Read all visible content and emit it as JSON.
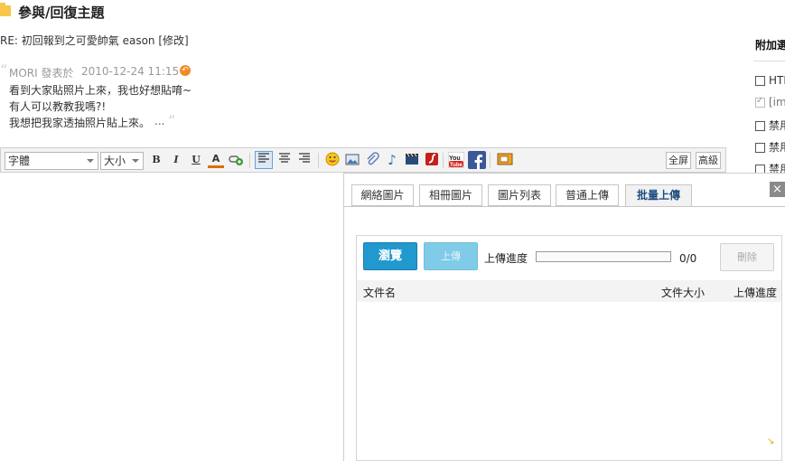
{
  "header": {
    "title": "參與/回復主題",
    "subject": "RE: 初回報到之可愛帥氣 eason [修改]"
  },
  "quote": {
    "author": "MORI 發表於",
    "date": "2010-12-24 11:15",
    "lines": [
      "看到大家貼照片上來，我也好想貼唷~",
      "有人可以教教我嗎?!",
      "我想把我家透抽照片貼上來。"
    ],
    "ellipsis": "..."
  },
  "toolbar": {
    "font_select": "字體",
    "size_select": "大小",
    "bold": "B",
    "italic": "I",
    "underline": "U",
    "fontcolor": "A",
    "fullscreen": "全屏",
    "advanced": "高級"
  },
  "sidebar": {
    "title": "附加選項",
    "options": [
      {
        "label": "HTML",
        "checked": false
      },
      {
        "label": "[img]",
        "checked": true
      },
      {
        "label": "禁用",
        "checked": false
      },
      {
        "label": "禁用",
        "checked": false
      },
      {
        "label": "禁用",
        "checked": false
      }
    ]
  },
  "dialog": {
    "tabs": [
      {
        "label": "網絡圖片"
      },
      {
        "label": "相冊圖片"
      },
      {
        "label": "圖片列表"
      },
      {
        "label": "普通上傳"
      },
      {
        "label": "批量上傳"
      }
    ],
    "active_tab": 4,
    "browse_button": "瀏覽",
    "upload_button": "上傳",
    "progress_label": "上傳進度",
    "progress_fraction": 0,
    "progress_count": "0/0",
    "delete_button": "刪除",
    "columns": {
      "name": "文件名",
      "size": "文件大小",
      "progress": "上傳進度"
    },
    "close": "×"
  },
  "colors": {
    "accent": "#2199cf",
    "active_tab_text": "#1d4e80",
    "folder_icon": "#f7c64a",
    "reply_icon": "#f08a24"
  }
}
